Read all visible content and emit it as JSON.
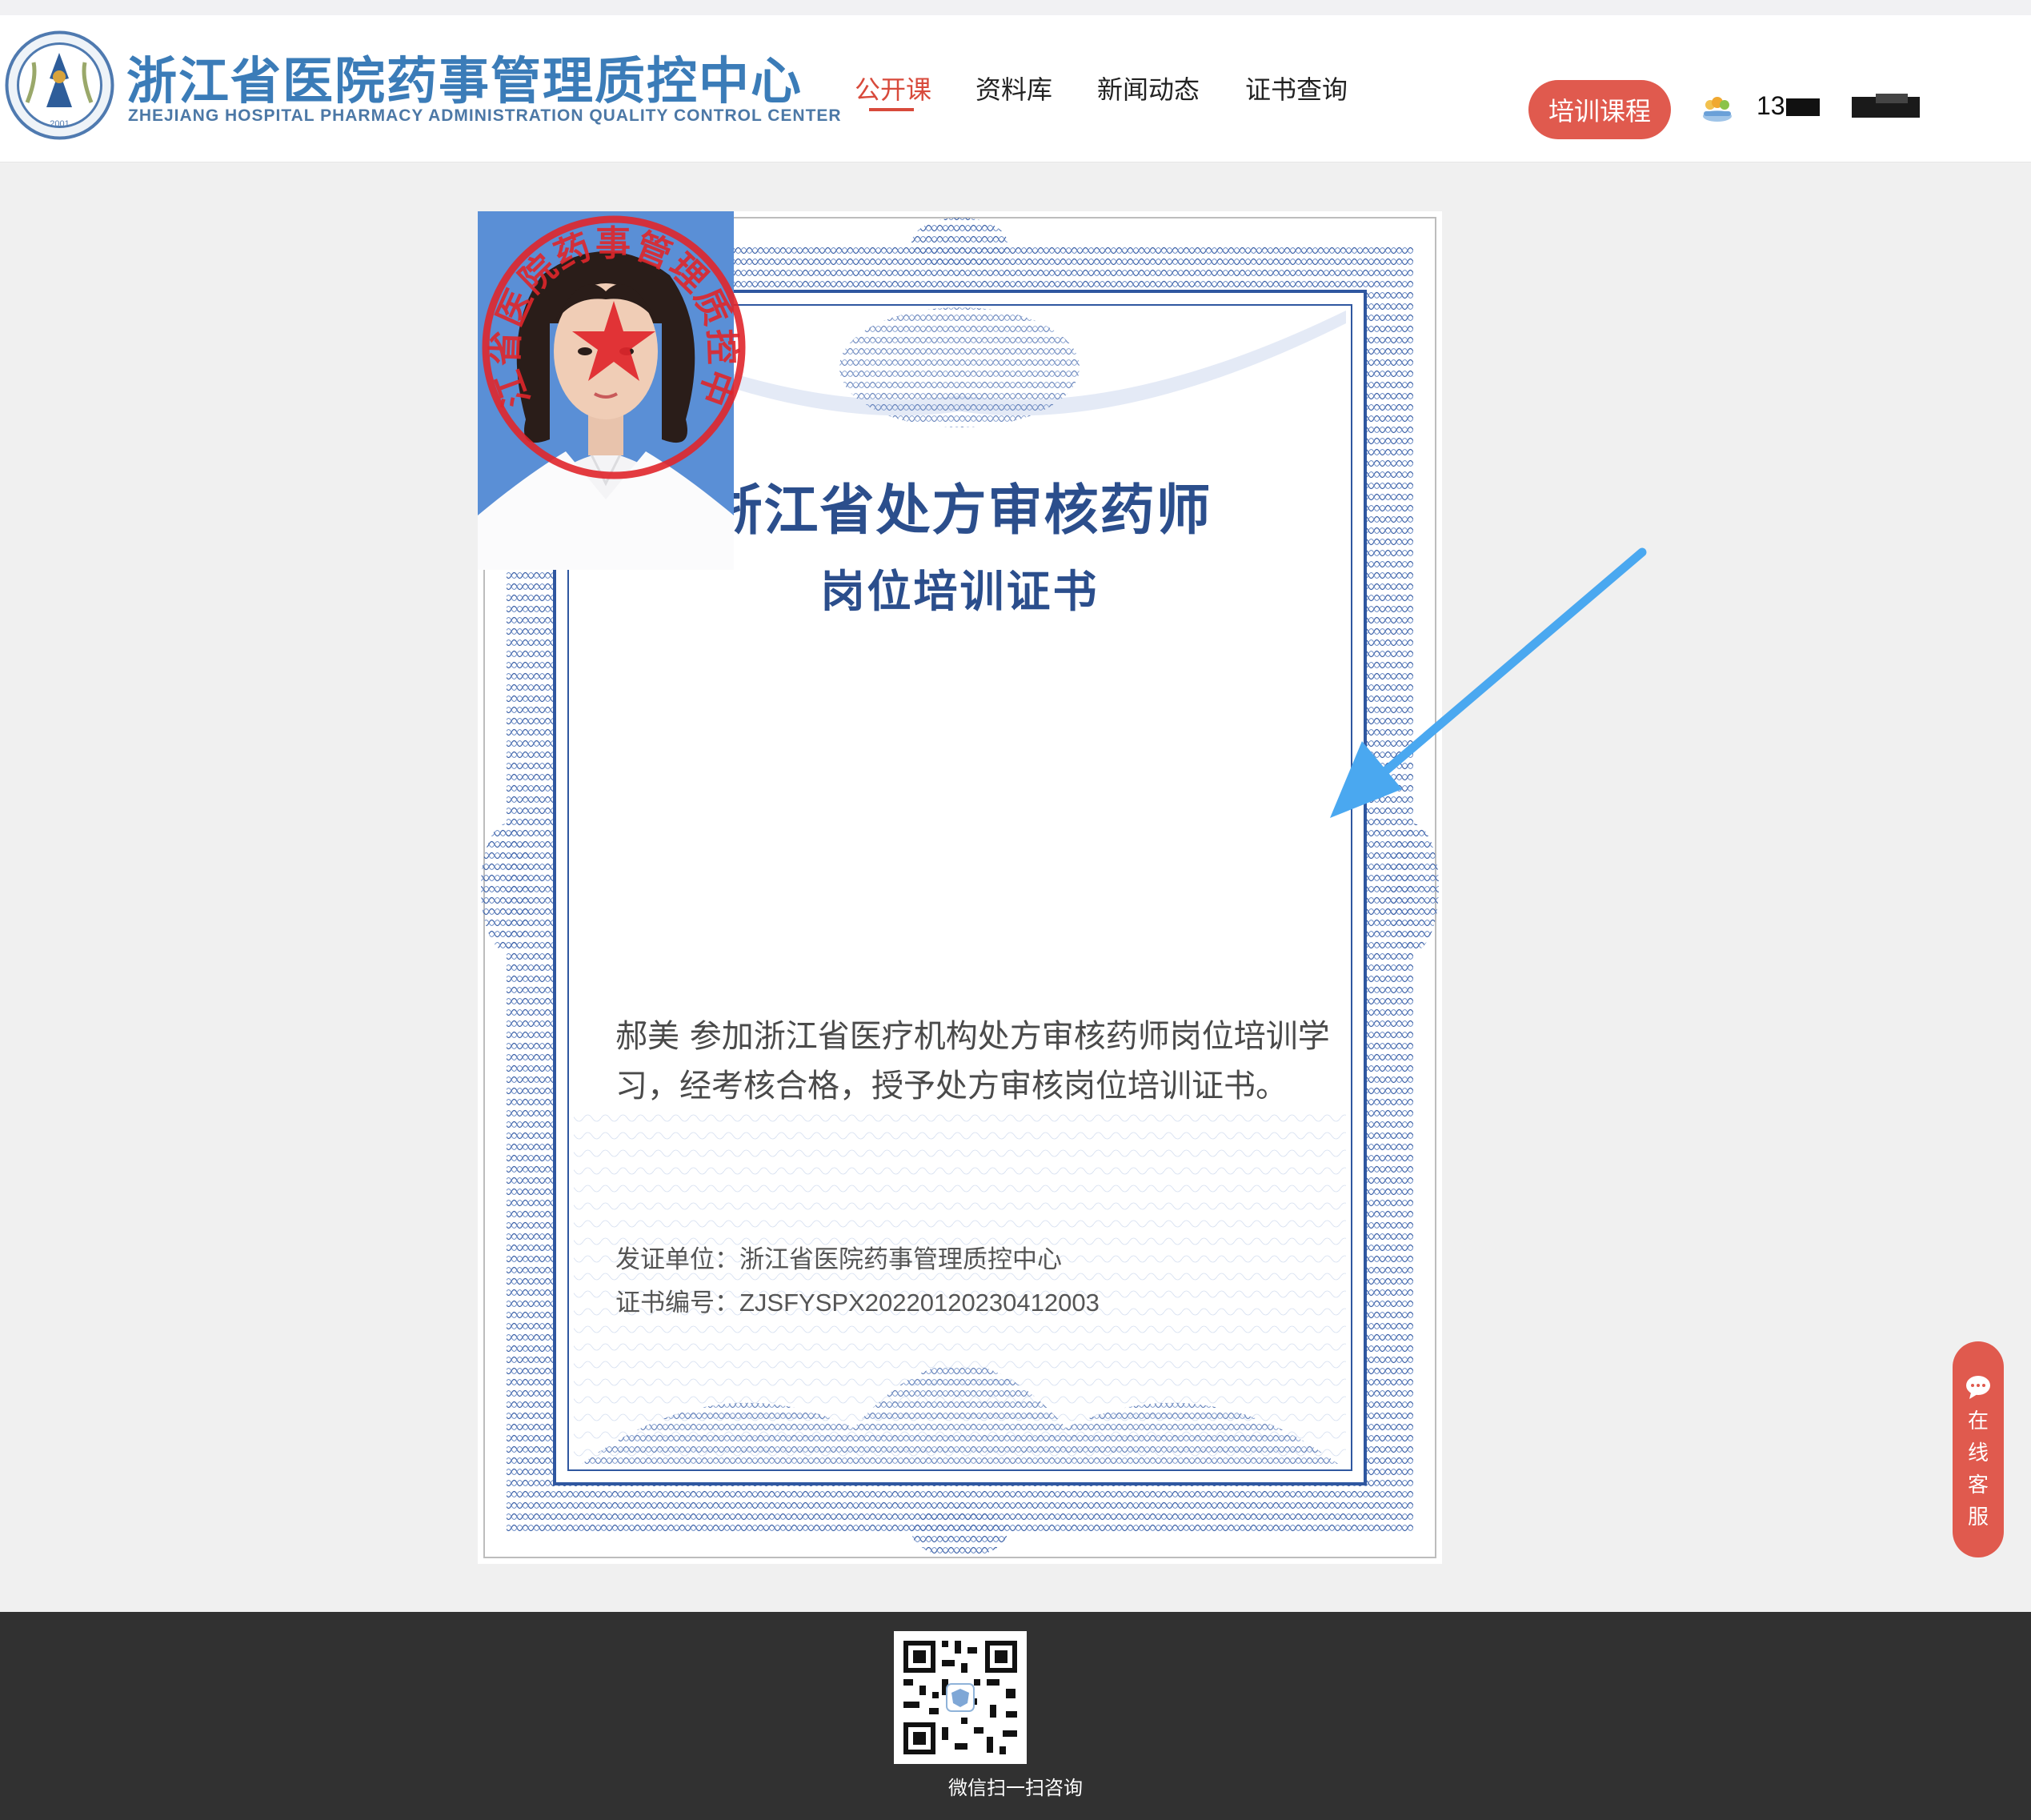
{
  "header": {
    "logo_cn": "浙江省医院药事管理质控中心",
    "logo_en": "ZHEJIANG HOSPITAL PHARMACY ADMINISTRATION QUALITY CONTROL CENTER",
    "logo_year": "2001",
    "nav": [
      "公开课",
      "资料库",
      "新闻动态",
      "证书查询"
    ],
    "active_nav": "公开课",
    "cta_label": "培训课程",
    "user_phone_prefix": "13"
  },
  "certificate": {
    "title_line1": "浙江省处方审核药师",
    "title_line2": "岗位培训证书",
    "body": "郝美 参加浙江省医疗机构处方审核药师岗位培训学习，经考核合格，授予处方审核岗位培训证书。",
    "issuer_label": "发证单位：",
    "issuer_value": "浙江省医院药事管理质控中心",
    "number_label": "证书编号：",
    "number_value": "ZJSFYSPX20220120230412003",
    "seal_text": "浙江省医院药事管理质控中心"
  },
  "chat": {
    "label": "在线客服"
  },
  "footer": {
    "qr_label": "微信扫一扫咨询"
  },
  "colors": {
    "accent": "#e05a4e",
    "nav_active": "#d84a3b",
    "cert_border": "#2f57a0",
    "cert_title": "#2b4e8c",
    "seal": "#e0262b",
    "arrow": "#4aa8f0",
    "footer_bg": "#313131"
  }
}
